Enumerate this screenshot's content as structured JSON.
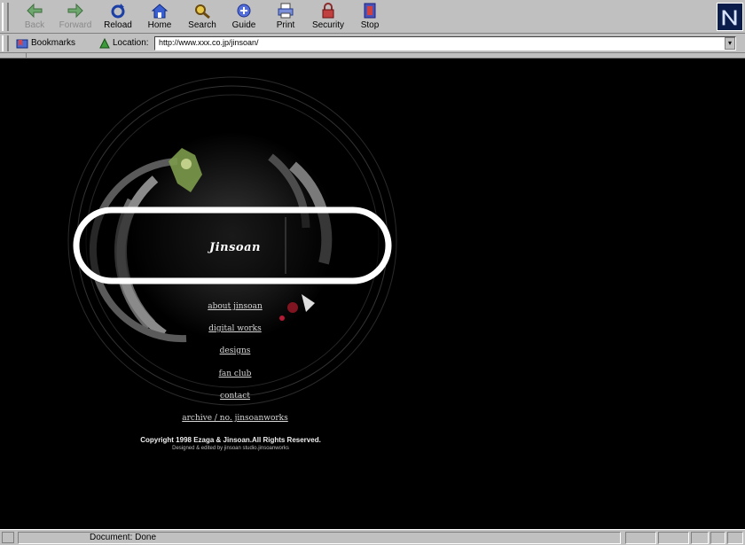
{
  "toolbar": {
    "buttons": [
      {
        "label": "Back",
        "icon": "back-arrow-icon",
        "enabled": false
      },
      {
        "label": "Forward",
        "icon": "forward-arrow-icon",
        "enabled": false
      },
      {
        "label": "Reload",
        "icon": "reload-icon",
        "enabled": true
      },
      {
        "label": "Home",
        "icon": "home-icon",
        "enabled": true
      },
      {
        "label": "Search",
        "icon": "search-icon",
        "enabled": true
      },
      {
        "label": "Guide",
        "icon": "guide-icon",
        "enabled": true
      },
      {
        "label": "Print",
        "icon": "print-icon",
        "enabled": true
      },
      {
        "label": "Security",
        "icon": "security-lock-icon",
        "enabled": true
      },
      {
        "label": "Stop",
        "icon": "stop-icon",
        "enabled": true
      }
    ]
  },
  "location_bar": {
    "bookmarks_label": "Bookmarks",
    "location_label": "Location:",
    "url": "http://www.xxx.co.jp/jinsoan/"
  },
  "page": {
    "brand": "Jinsoan",
    "menu": [
      {
        "label": "about jinsoan"
      },
      {
        "label": "digital works"
      },
      {
        "label": "designs"
      },
      {
        "label": "fan club"
      },
      {
        "label": "contact"
      },
      {
        "label": "archive / no. jinsoanworks"
      }
    ],
    "copyright": "Copyright 1998 Ezaga & Jinsoan.All Rights Reserved.",
    "credits": "Designed & edited by jinsoan studio.jinsoanworks"
  },
  "status_bar": {
    "text": "Document: Done"
  },
  "colors": {
    "chrome": "#c0c0c0",
    "page_bg": "#000000",
    "ring": "#ffffff"
  }
}
